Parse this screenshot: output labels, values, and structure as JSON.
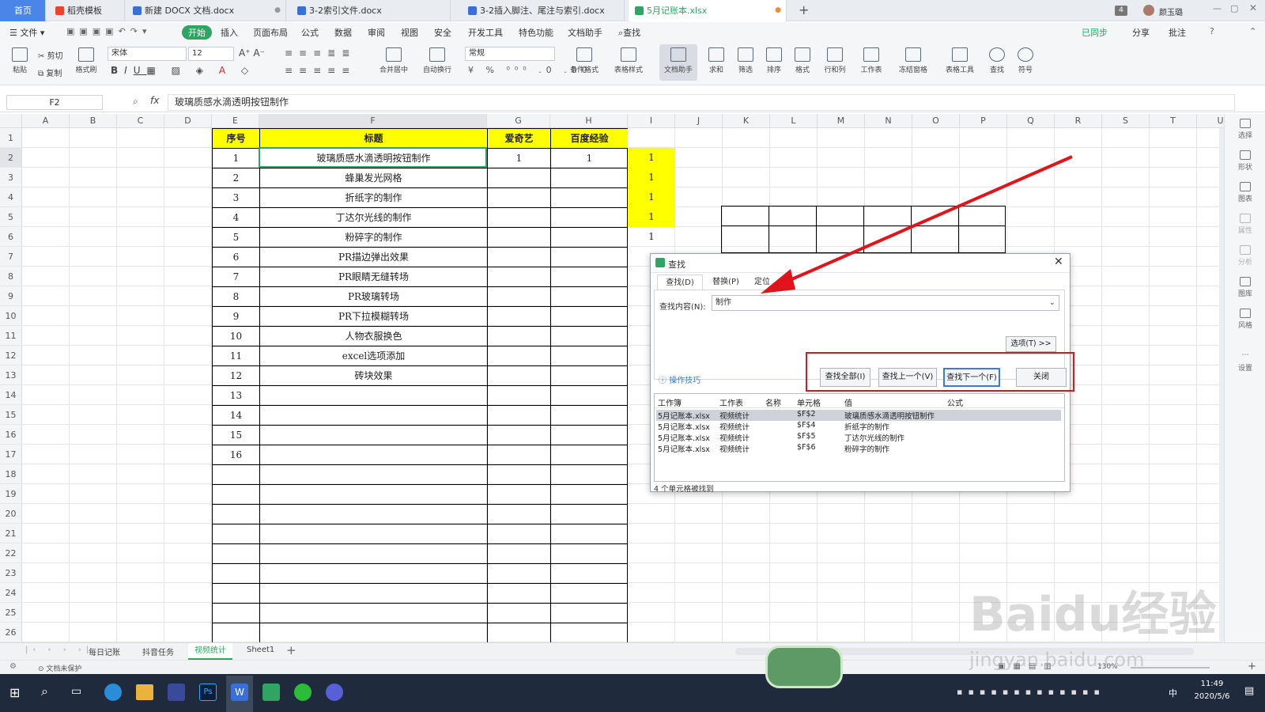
{
  "tabs": [
    {
      "label": "首页",
      "type": "home"
    },
    {
      "label": "稻壳模板",
      "type": "docer"
    },
    {
      "label": "新建 DOCX 文档.docx",
      "type": "word"
    },
    {
      "label": "3-2索引文件.docx",
      "type": "word"
    },
    {
      "label": "3-2插入脚注、尾注与索引.docx",
      "type": "word"
    },
    {
      "label": "5月记账本.xlsx",
      "type": "sheet",
      "active": true
    }
  ],
  "window": {
    "badge": "4",
    "user": "颜玉璐"
  },
  "menu": {
    "file": "文件",
    "items": [
      "开始",
      "插入",
      "页面布局",
      "公式",
      "数据",
      "审阅",
      "视图",
      "安全",
      "开发工具",
      "特色功能",
      "文档助手"
    ],
    "search": "查找",
    "right": [
      "已同步",
      "分享",
      "批注"
    ]
  },
  "ribbon": {
    "paste": "粘贴",
    "cut": "剪切",
    "copy": "复制",
    "format_painter": "格式刷",
    "font": "宋体",
    "size": "12",
    "merge": "合并居中",
    "wrap": "自动换行",
    "number_format": "常规",
    "tools": [
      "条件格式",
      "表格样式",
      "文档助手",
      "求和",
      "筛选",
      "排序",
      "格式",
      "行和列",
      "工作表",
      "冻结窗格",
      "表格工具",
      "查找",
      "符号"
    ]
  },
  "formula_bar": {
    "cell_ref": "F2",
    "fx": "fx",
    "content": "玻璃质感水滴透明按钮制作"
  },
  "columns": [
    "A",
    "B",
    "C",
    "D",
    "E",
    "F",
    "G",
    "H",
    "I",
    "J",
    "K",
    "L",
    "M",
    "N",
    "O",
    "P",
    "Q",
    "R",
    "S",
    "T",
    "U"
  ],
  "headers": {
    "seq": "序号",
    "title": "标题",
    "iqiyi": "爱奇艺",
    "baidu": "百度经验"
  },
  "rows": [
    {
      "seq": "1",
      "title": "玻璃质感水滴透明按钮制作",
      "iqiyi": "1",
      "baidu": "1",
      "i": "1"
    },
    {
      "seq": "2",
      "title": "蜂巢发光网格",
      "iqiyi": "",
      "baidu": "",
      "i": "1"
    },
    {
      "seq": "3",
      "title": "折纸字的制作",
      "iqiyi": "",
      "baidu": "",
      "i": "1"
    },
    {
      "seq": "4",
      "title": "丁达尔光线的制作",
      "iqiyi": "",
      "baidu": "",
      "i": "1"
    },
    {
      "seq": "5",
      "title": "粉碎字的制作",
      "iqiyi": "",
      "baidu": "",
      "i": "1"
    },
    {
      "seq": "6",
      "title": "PR描边弹出效果",
      "iqiyi": "",
      "baidu": "",
      "i": ""
    },
    {
      "seq": "7",
      "title": "PR眼睛无缝转场",
      "iqiyi": "",
      "baidu": "",
      "i": ""
    },
    {
      "seq": "8",
      "title": "PR玻璃转场",
      "iqiyi": "",
      "baidu": "",
      "i": ""
    },
    {
      "seq": "9",
      "title": "PR下拉模糊转场",
      "iqiyi": "",
      "baidu": "",
      "i": ""
    },
    {
      "seq": "10",
      "title": "人物衣服换色",
      "iqiyi": "",
      "baidu": "",
      "i": ""
    },
    {
      "seq": "11",
      "title": "excel选项添加",
      "iqiyi": "",
      "baidu": "",
      "i": ""
    },
    {
      "seq": "12",
      "title": "砖块效果",
      "iqiyi": "",
      "baidu": "",
      "i": ""
    },
    {
      "seq": "13",
      "title": "",
      "iqiyi": "",
      "baidu": "",
      "i": ""
    },
    {
      "seq": "14",
      "title": "",
      "iqiyi": "",
      "baidu": "",
      "i": ""
    },
    {
      "seq": "15",
      "title": "",
      "iqiyi": "",
      "baidu": "",
      "i": ""
    },
    {
      "seq": "16",
      "title": "",
      "iqiyi": "",
      "baidu": "",
      "i": ""
    }
  ],
  "row_numbers": [
    "1",
    "2",
    "3",
    "4",
    "5",
    "6",
    "7",
    "8",
    "9",
    "10",
    "11",
    "12",
    "13",
    "14",
    "15",
    "16",
    "17",
    "18",
    "19",
    "20",
    "21",
    "22",
    "23",
    "24",
    "25",
    "26",
    "27"
  ],
  "dialog": {
    "title": "查找",
    "tabs": [
      "查找(D)",
      "替换(P)",
      "定位"
    ],
    "find_label": "查找内容(N):",
    "find_value": "制作",
    "options": "选项(T) >>",
    "tips": "操作技巧",
    "buttons": {
      "find_all": "查找全部(I)",
      "find_prev": "查找上一个(V)",
      "find_next": "查找下一个(F)",
      "close": "关闭"
    },
    "result_headers": [
      "工作簿",
      "工作表",
      "名称",
      "单元格",
      "值",
      "公式"
    ],
    "results": [
      {
        "book": "5月记账本.xlsx",
        "sheet": "视频统计",
        "name": "",
        "cell": "$F$2",
        "value": "玻璃质感水滴透明按钮制作",
        "formula": ""
      },
      {
        "book": "5月记账本.xlsx",
        "sheet": "视频统计",
        "name": "",
        "cell": "$F$4",
        "value": "折纸字的制作",
        "formula": ""
      },
      {
        "book": "5月记账本.xlsx",
        "sheet": "视频统计",
        "name": "",
        "cell": "$F$5",
        "value": "丁达尔光线的制作",
        "formula": ""
      },
      {
        "book": "5月记账本.xlsx",
        "sheet": "视频统计",
        "name": "",
        "cell": "$F$6",
        "value": "粉碎字的制作",
        "formula": ""
      }
    ],
    "status": "4 个单元格被找到"
  },
  "sheet_tabs": [
    "每日记账",
    "抖音任务",
    "视频统计",
    "Sheet1"
  ],
  "active_sheet": "视频统计",
  "status": {
    "protect": "文档未保护",
    "zoom": "130%"
  },
  "right_panel": [
    "选择",
    "形状",
    "图表",
    "属性",
    "分析",
    "图库",
    "风格",
    "设置"
  ],
  "taskbar": {
    "time": "11:49",
    "date": "2020/5/6",
    "ime": "中"
  },
  "watermark": {
    "brand": "Baidu经验",
    "url": "jingyan.baidu.com"
  },
  "colors": {
    "highlight_yellow": "#ffff00",
    "annotation_red": "#e0141a",
    "wps_green": "#2fa463",
    "home_blue": "#4a86e8"
  }
}
